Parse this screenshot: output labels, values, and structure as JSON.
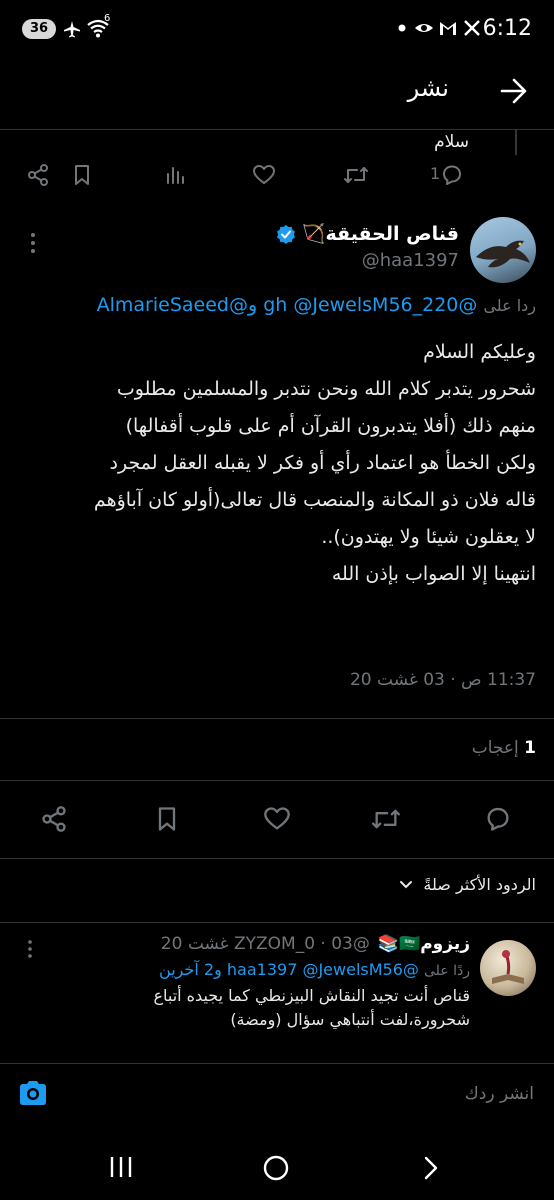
{
  "status_bar": {
    "badge": "36",
    "time": "6:12",
    "wifi_label": "6"
  },
  "header": {
    "title": "نشر"
  },
  "prev_tweet": {
    "tail_text": "سلام",
    "reply_count": "1"
  },
  "main_tweet": {
    "author_name": "قناص الحقيقة🏹",
    "handle": "@haa1397",
    "reply_prefix": "ردا على",
    "reply_to": "@220_gh @JewelsM56 و@AlmarieSaeed",
    "lines": [
      "وعليكم السلام",
      "شحرور يتدبر كلام الله ونحن نتدبر والمسلمين مطلوب",
      "منهم ذلك (أفلا يتدبرون القرآن أم على قلوب أقفالها)",
      "ولكن الخطأ هو اعتماد رأي أو فكر لا يقبله العقل لمجرد",
      "قاله فلان ذو المكانة والمنصب قال تعالى(أولو كان آباؤهم",
      "لا يعقلون شيئا ولا يهتدون)..",
      "انتهينا إلا الصواب بإذن الله"
    ],
    "timestamp": "11:37 ص · 03 غشت 20",
    "likes_count": "1",
    "likes_label": "إعجاب"
  },
  "sort": {
    "label": "الردود الأكثر صلةً"
  },
  "reply": {
    "author_name": "زيزوم🇸🇦📚",
    "handle_time": "@ZYZOM_0 · 03 غشت 20",
    "reply_prefix": "ردًا على",
    "reply_to": "@haa1397 @JewelsM56 و2 آخرين",
    "text_lines": [
      "قناص أنت تجيد النقاش البيزنطي كما يجيده أتباع",
      "شحرورة،لفت أنتباهي سؤال (ومضة)"
    ]
  },
  "compose": {
    "placeholder": "انشر ردك"
  },
  "colors": {
    "accent": "#1d9bf0",
    "muted": "#71767b",
    "verified": "#1d9bf0"
  }
}
